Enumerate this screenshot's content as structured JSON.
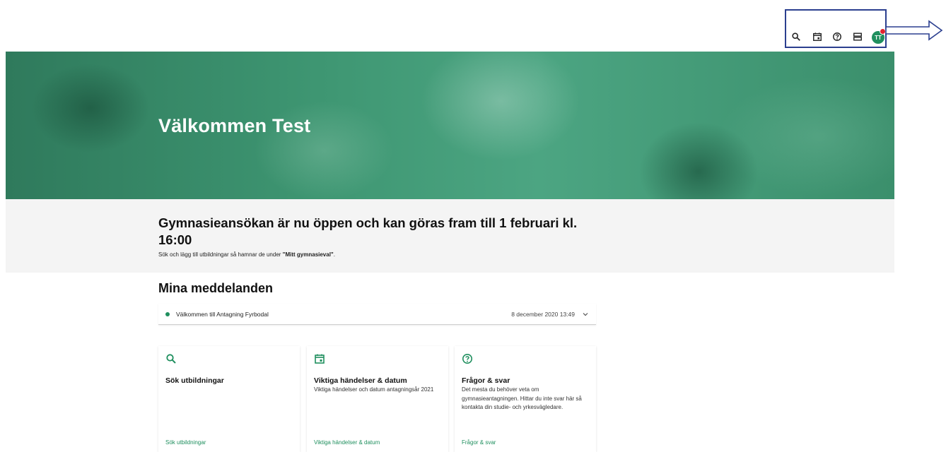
{
  "toolbar": {
    "icons": [
      "search-icon",
      "calendar-icon",
      "help-icon",
      "menu-icon"
    ],
    "avatar_initials": "TT"
  },
  "hero": {
    "title": "Välkommen Test"
  },
  "banner": {
    "title": "Gymnasieansökan är nu öppen och kan göras fram till 1 februari kl. 16:00",
    "subtitle_prefix": "Sök och lägg till utbildningar så hamnar de under ",
    "subtitle_bold": "\"Mitt gymnasieval\"",
    "subtitle_suffix": "."
  },
  "messages": {
    "heading": "Mina meddelanden",
    "items": [
      {
        "text": "Välkommen till Antagning Fyrbodal",
        "date": "8 december 2020 13:49"
      }
    ]
  },
  "cards": [
    {
      "icon": "search-icon",
      "title": "Sök utbildningar",
      "description": "",
      "link": "Sök utbildningar"
    },
    {
      "icon": "calendar-icon",
      "title": "Viktiga händelser & datum",
      "description": "Viktiga händelser och datum antagningsår 2021",
      "link": "Viktiga händelser & datum"
    },
    {
      "icon": "help-icon",
      "title": "Frågor & svar",
      "description": "Det mesta du behöver veta om gymnasieantagningen. Hittar du inte svar här så kontakta din studie- och yrkesvägledare.",
      "link": "Frågor & svar"
    }
  ],
  "colors": {
    "accent": "#1f8f5e",
    "annotation": "#2b3f8f",
    "badge": "#e0242e"
  }
}
